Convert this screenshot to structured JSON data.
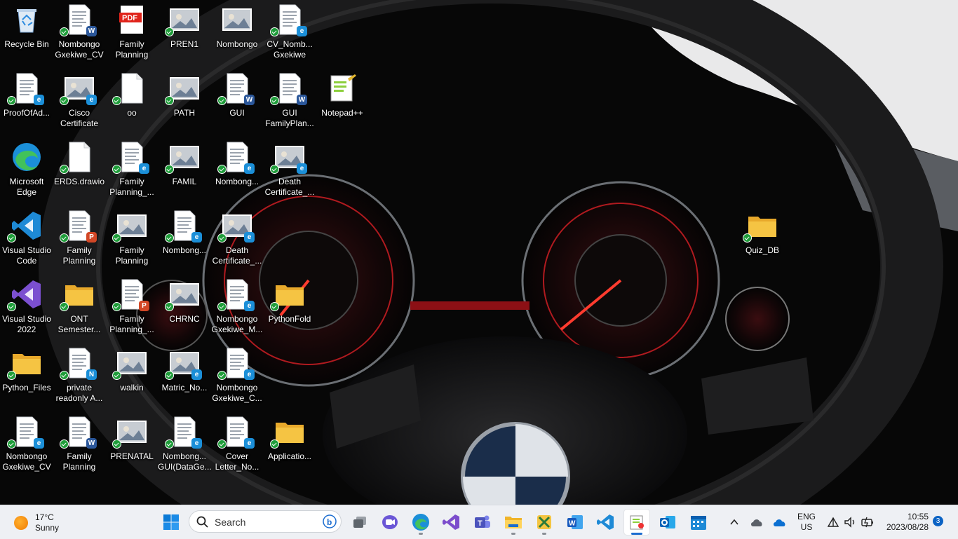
{
  "desktop": {
    "icons": [
      {
        "label": "Recycle Bin",
        "type": "recycle",
        "sync": false,
        "badge": ""
      },
      {
        "label": "Nombongo\nGxekiwe_CV",
        "type": "doc",
        "sync": true,
        "badge": "W"
      },
      {
        "label": "Family\nPlanning",
        "type": "pdf",
        "sync": false,
        "badge": ""
      },
      {
        "label": "PREN1",
        "type": "photo",
        "sync": true,
        "badge": ""
      },
      {
        "label": "Nombongo",
        "type": "photo",
        "sync": false,
        "badge": ""
      },
      {
        "label": "CV_Nomb...\nGxekiwe",
        "type": "doc",
        "sync": true,
        "badge": "E"
      },
      {
        "label": "ProofOfAd...",
        "type": "doc",
        "sync": true,
        "badge": "E"
      },
      {
        "label": "Cisco\nCertificate",
        "type": "photo",
        "sync": true,
        "badge": "E"
      },
      {
        "label": "oo",
        "type": "blank",
        "sync": true,
        "badge": ""
      },
      {
        "label": "PATH",
        "type": "photo",
        "sync": true,
        "badge": ""
      },
      {
        "label": "GUI",
        "type": "doc",
        "sync": true,
        "badge": "W"
      },
      {
        "label": "GUI\nFamilyPlan...",
        "type": "doc",
        "sync": true,
        "badge": "W"
      },
      {
        "label": "Notepad++",
        "type": "notepad",
        "sync": false,
        "badge": ""
      },
      {
        "label": "Microsoft\nEdge",
        "type": "edge",
        "sync": false,
        "badge": ""
      },
      {
        "label": "ERDS.drawio",
        "type": "blank",
        "sync": true,
        "badge": ""
      },
      {
        "label": "Family\nPlanning_...",
        "type": "doc",
        "sync": true,
        "badge": "E"
      },
      {
        "label": "FAMIL",
        "type": "photo",
        "sync": true,
        "badge": ""
      },
      {
        "label": "Nombong...",
        "type": "doc",
        "sync": true,
        "badge": "E"
      },
      {
        "label": "Death\nCertificate_...",
        "type": "photo",
        "sync": true,
        "badge": "E"
      },
      {
        "label": "Quiz_DB",
        "type": "folder",
        "sync": true,
        "badge": ""
      },
      {
        "label": "Visual Studio\nCode",
        "type": "vscode",
        "sync": true,
        "badge": ""
      },
      {
        "label": "Family\nPlanning",
        "type": "doc",
        "sync": true,
        "badge": "P"
      },
      {
        "label": "Family\nPlanning",
        "type": "photo",
        "sync": true,
        "badge": ""
      },
      {
        "label": "Nombong...",
        "type": "doc",
        "sync": true,
        "badge": "E"
      },
      {
        "label": "Death\nCertificate_...",
        "type": "photo",
        "sync": true,
        "badge": "E"
      },
      {
        "label": "Visual Studio\n2022",
        "type": "vs",
        "sync": true,
        "badge": ""
      },
      {
        "label": "ONT\nSemester...",
        "type": "folder",
        "sync": true,
        "badge": ""
      },
      {
        "label": "Family\nPlanning_...",
        "type": "doc",
        "sync": true,
        "badge": "P"
      },
      {
        "label": "CHRNC",
        "type": "photo",
        "sync": true,
        "badge": ""
      },
      {
        "label": "Nombongo\nGxekiwe_M...",
        "type": "doc",
        "sync": true,
        "badge": "E"
      },
      {
        "label": "PythonFold",
        "type": "folder",
        "sync": true,
        "badge": ""
      },
      {
        "label": "Python_Files",
        "type": "folder",
        "sync": true,
        "badge": ""
      },
      {
        "label": "private\nreadonly A...",
        "type": "doc",
        "sync": true,
        "badge": "N"
      },
      {
        "label": "walkin",
        "type": "photo",
        "sync": true,
        "badge": ""
      },
      {
        "label": "Matric_No...",
        "type": "photo",
        "sync": true,
        "badge": "E"
      },
      {
        "label": "Nombongo\nGxekiwe_C...",
        "type": "doc",
        "sync": true,
        "badge": "E"
      },
      {
        "label": "Nombongo\nGxekiwe_CV",
        "type": "doc",
        "sync": true,
        "badge": "E"
      },
      {
        "label": "Family\nPlanning",
        "type": "doc",
        "sync": true,
        "badge": "W"
      },
      {
        "label": "PRENATAL",
        "type": "photo",
        "sync": true,
        "badge": ""
      },
      {
        "label": "Nombong...\nGUI(DataGe...",
        "type": "doc",
        "sync": true,
        "badge": "E"
      },
      {
        "label": "Cover\nLetter_No...",
        "type": "doc",
        "sync": true,
        "badge": "E"
      },
      {
        "label": "Applicatio...",
        "type": "folder",
        "sync": true,
        "badge": ""
      }
    ]
  },
  "colors": {
    "word": "#2b579a",
    "edge": "#1b8fd8",
    "powerpoint": "#d24726",
    "folder": "#f5c443",
    "taskbar": "#eef0f4",
    "accent": "#1c6dd0"
  },
  "taskbar": {
    "weather": {
      "temp": "17°C",
      "condition": "Sunny"
    },
    "search_placeholder": "Search",
    "apps": [
      {
        "name": "start",
        "icon": "windows-icon"
      },
      {
        "name": "task-view",
        "icon": "task-view-icon"
      },
      {
        "name": "chat",
        "icon": "chat-icon"
      },
      {
        "name": "edge",
        "icon": "edge-icon"
      },
      {
        "name": "visual-studio",
        "icon": "visual-studio-icon"
      },
      {
        "name": "teams",
        "icon": "teams-icon"
      },
      {
        "name": "file-explorer",
        "icon": "folder-icon"
      },
      {
        "name": "snip",
        "icon": "snip-icon"
      },
      {
        "name": "word",
        "icon": "word-icon"
      },
      {
        "name": "vscode",
        "icon": "vscode-icon"
      },
      {
        "name": "notepad-plus",
        "icon": "notepad-plus-icon"
      },
      {
        "name": "outlook",
        "icon": "outlook-icon"
      },
      {
        "name": "calendar",
        "icon": "calendar-icon"
      }
    ],
    "tray": {
      "lang_top": "ENG",
      "lang_bottom": "US",
      "time": "10:55",
      "date": "2023/08/28",
      "notifications": "3"
    }
  }
}
